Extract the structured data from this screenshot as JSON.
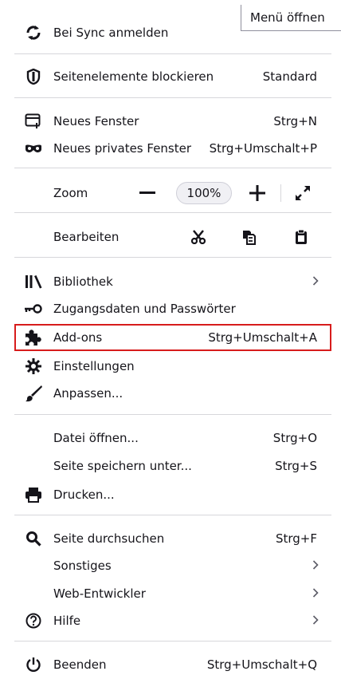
{
  "tooltip": "Menü öffnen",
  "items": {
    "sync": {
      "label": "Bei Sync anmelden",
      "icon": "sync-icon"
    },
    "block": {
      "label": "Seitenelemente blockieren",
      "shortcut": "Standard",
      "icon": "shield-icon"
    },
    "new_window": {
      "label": "Neues Fenster",
      "shortcut": "Strg+N",
      "icon": "new-window-icon"
    },
    "private_window": {
      "label": "Neues privates Fenster",
      "shortcut": "Strg+Umschalt+P",
      "icon": "mask-icon"
    },
    "zoom": {
      "label": "Zoom",
      "value": "100%"
    },
    "edit": {
      "label": "Bearbeiten"
    },
    "library": {
      "label": "Bibliothek",
      "icon": "library-icon"
    },
    "passwords": {
      "label": "Zugangsdaten und Passwörter",
      "icon": "key-icon"
    },
    "addons": {
      "label": "Add-ons",
      "shortcut": "Strg+Umschalt+A",
      "icon": "puzzle-icon"
    },
    "settings": {
      "label": "Einstellungen",
      "icon": "gear-icon"
    },
    "customize": {
      "label": "Anpassen...",
      "icon": "brush-icon"
    },
    "open_file": {
      "label": "Datei öffnen...",
      "shortcut": "Strg+O"
    },
    "save_page": {
      "label": "Seite speichern unter...",
      "shortcut": "Strg+S"
    },
    "print": {
      "label": "Drucken...",
      "icon": "printer-icon"
    },
    "find": {
      "label": "Seite durchsuchen",
      "shortcut": "Strg+F",
      "icon": "search-icon"
    },
    "more": {
      "label": "Sonstiges"
    },
    "dev": {
      "label": "Web-Entwickler"
    },
    "help": {
      "label": "Hilfe",
      "icon": "help-icon"
    },
    "quit": {
      "label": "Beenden",
      "shortcut": "Strg+Umschalt+Q",
      "icon": "power-icon"
    }
  },
  "colors": {
    "highlight": "#d71c1c",
    "separator": "#d7d7db"
  }
}
